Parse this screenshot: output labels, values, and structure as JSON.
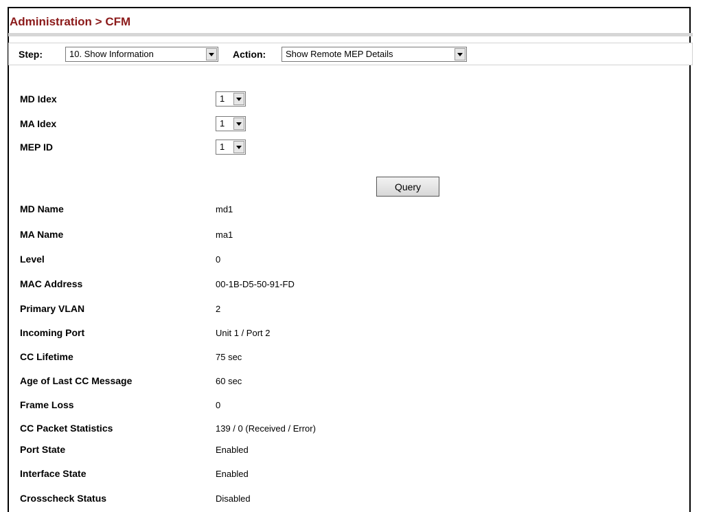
{
  "page": {
    "title": "Administration > CFM"
  },
  "stepbar": {
    "step_label": "Step:",
    "step_value": "10. Show Information",
    "action_label": "Action:",
    "action_value": "Show Remote MEP Details"
  },
  "selectors": [
    {
      "label": "MD Idex",
      "value": "1"
    },
    {
      "label": "MA Idex",
      "value": "1"
    },
    {
      "label": "MEP ID",
      "value": "1"
    }
  ],
  "query_button": "Query",
  "details": [
    {
      "label": "MD Name",
      "value": "md1"
    },
    {
      "label": "MA Name",
      "value": "ma1"
    },
    {
      "label": "Level",
      "value": "0"
    },
    {
      "label": "MAC Address",
      "value": "00-1B-D5-50-91-FD"
    },
    {
      "label": "Primary VLAN",
      "value": "2"
    },
    {
      "label": "Incoming Port",
      "value": "Unit 1 / Port 2"
    },
    {
      "label": "CC Lifetime",
      "value": "75 sec"
    },
    {
      "label": "Age of Last CC Message",
      "value": "60 sec"
    },
    {
      "label": "Frame Loss",
      "value": "0"
    },
    {
      "label": "CC Packet Statistics",
      "value": "139 / 0 (Received / Error)"
    },
    {
      "label": "Port State",
      "value": "Enabled"
    },
    {
      "label": "Interface State",
      "value": "Enabled"
    },
    {
      "label": "Crosscheck Status",
      "value": "Disabled"
    }
  ]
}
